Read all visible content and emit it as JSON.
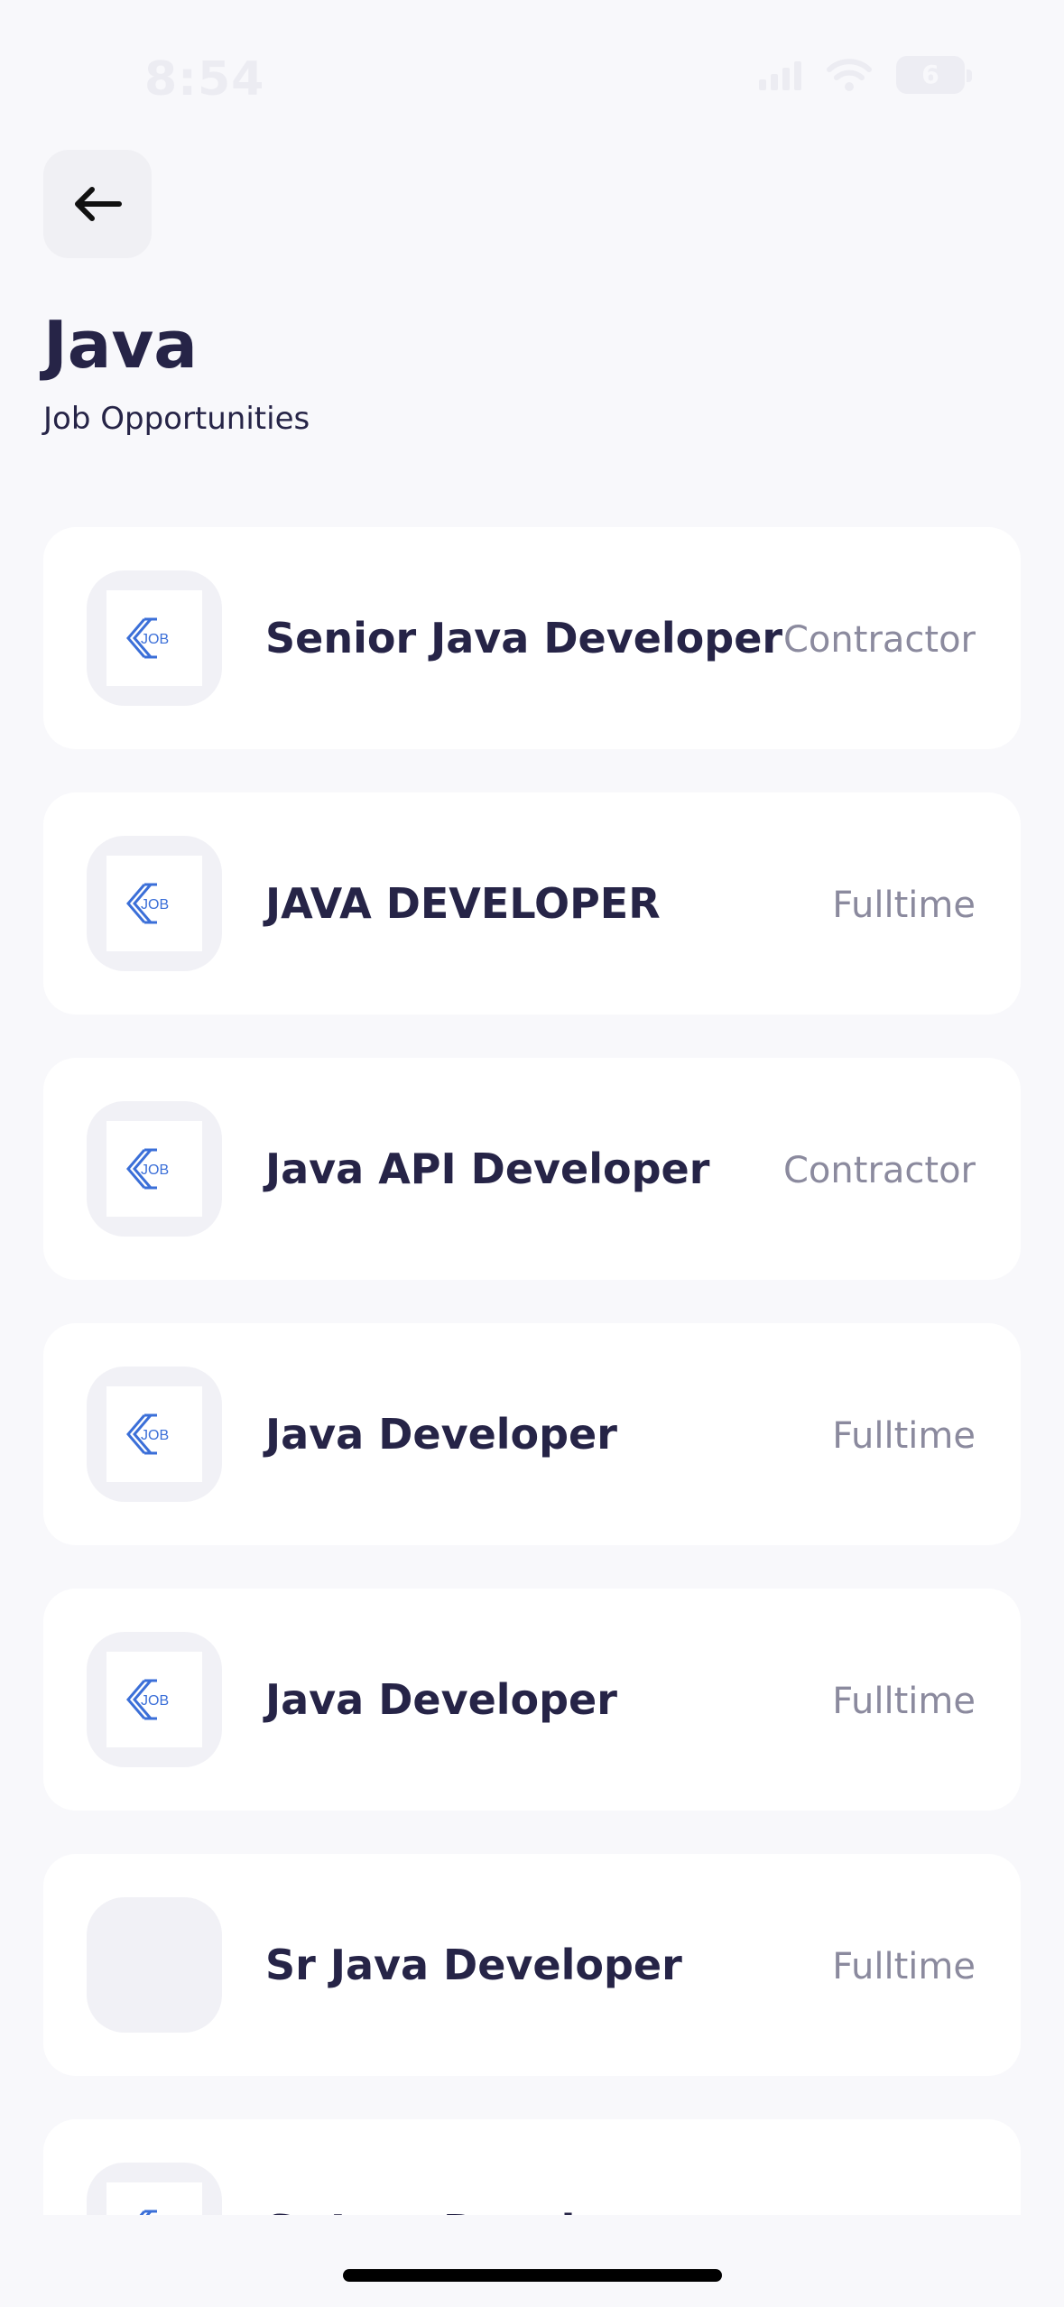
{
  "status_bar": {
    "time": "8:54",
    "battery": "6"
  },
  "header": {
    "title": "Java",
    "subtitle": "Job Opportunities"
  },
  "jobs": [
    {
      "title": "Senior Java Developer",
      "type": "Contractor",
      "has_logo": true
    },
    {
      "title": "JAVA DEVELOPER",
      "type": "Fulltime",
      "has_logo": true
    },
    {
      "title": "Java API Developer",
      "type": "Contractor",
      "has_logo": true
    },
    {
      "title": "Java Developer",
      "type": "Fulltime",
      "has_logo": true
    },
    {
      "title": "Java Developer",
      "type": "Fulltime",
      "has_logo": true
    },
    {
      "title": "Sr Java Developer",
      "type": "Fulltime",
      "has_logo": false
    },
    {
      "title": "Sr Java Developer",
      "type": "",
      "has_logo": true
    }
  ],
  "logo": {
    "text": "JOB",
    "color": "#3b6fd8"
  },
  "colors": {
    "background": "#f8f8fb",
    "card": "#ffffff",
    "title": "#262447",
    "muted": "#8b8a9e"
  }
}
